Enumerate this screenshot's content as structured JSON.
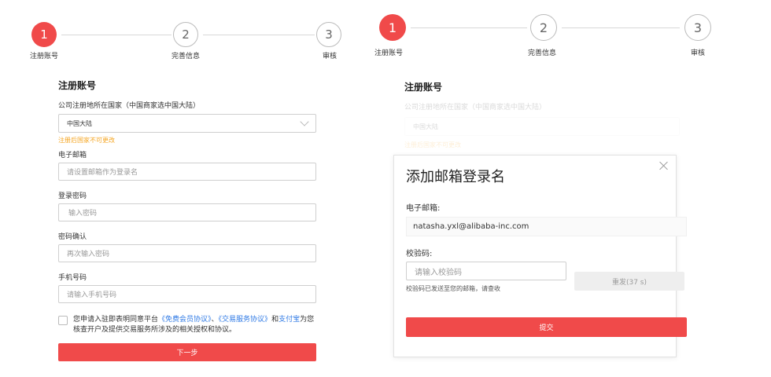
{
  "steps": [
    {
      "num": "1",
      "label": "注册账号"
    },
    {
      "num": "2",
      "label": "完善信息"
    },
    {
      "num": "3",
      "label": "审核"
    }
  ],
  "form": {
    "title": "注册账号",
    "country_label": "公司注册地所在国家（中国商家选中国大陆）",
    "country_value": "中国大陆",
    "country_hint": "注册后国家不可更改",
    "email_label": "电子邮箱",
    "email_placeholder": "请设置邮箱作为登录名",
    "password_label": "登录密码",
    "password_placeholder": "输入密码",
    "confirm_label": "密码确认",
    "confirm_placeholder": "再次输入密码",
    "phone_label": "手机号码",
    "phone_placeholder": "请输入手机号码",
    "agree_prefix": "您申请入驻即表明同意平台",
    "agree_link1": "《免费会员协议》",
    "agree_sep": "、",
    "agree_link2": "《交易服务协议》",
    "agree_and": "和",
    "agree_link3": "支付宝",
    "agree_suffix": "为您核查开户及提供交易服务所涉及的相关授权和协议。",
    "next_label": "下一步"
  },
  "modal": {
    "title": "添加邮箱登录名",
    "email_label": "电子邮箱:",
    "email_value": "natasha.yxl@alibaba-inc.com",
    "code_label": "校验码:",
    "code_placeholder": "请输入校验码",
    "code_hint": "校验码已发送至您的邮箱，请查收",
    "resend_label": "重发(37 s)",
    "submit_label": "提交"
  },
  "colors": {
    "accent": "#f04a4a",
    "link": "#2f7ae5",
    "warn": "#f5a623"
  }
}
